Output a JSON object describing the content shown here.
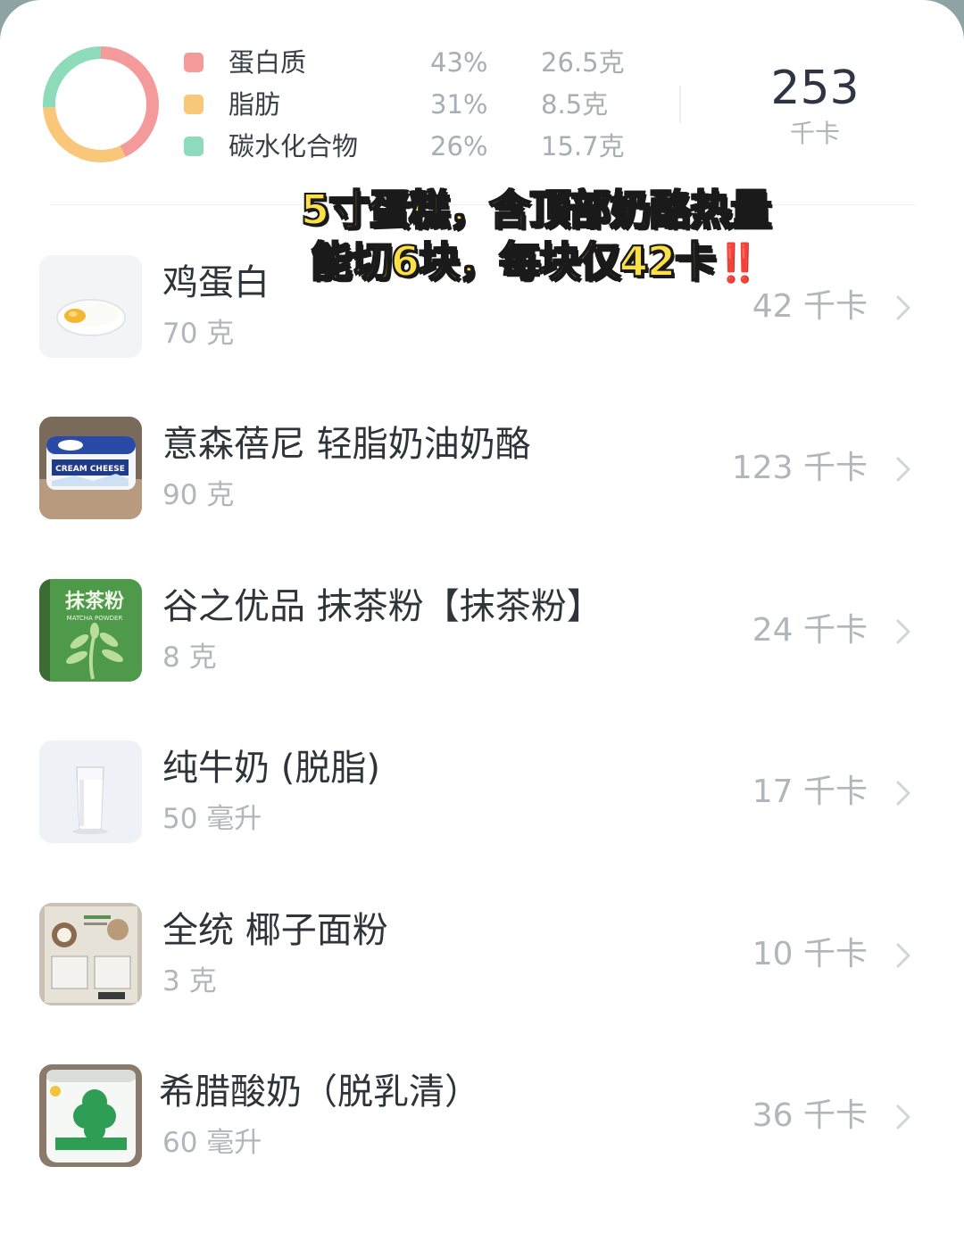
{
  "summary": {
    "macros": [
      {
        "name": "蛋白质",
        "percent": "43%",
        "grams": "26.5克",
        "color": "#f49a9a"
      },
      {
        "name": "脂肪",
        "percent": "31%",
        "grams": "8.5克",
        "color": "#f9c77a"
      },
      {
        "name": "碳水化合物",
        "percent": "26%",
        "grams": "15.7克",
        "color": "#8edbbb"
      }
    ],
    "total_calories": "253",
    "total_unit": "千卡",
    "macro_fractions": [
      0.43,
      0.31,
      0.26
    ]
  },
  "overlay": {
    "line1": "5寸蛋糕，含顶部奶酪热量",
    "line2": "能切6块，每块仅42卡",
    "emoji": "‼️"
  },
  "foods": [
    {
      "name": "鸡蛋白",
      "amount": "70 克",
      "calories": "42 千卡",
      "image": "egg-white-photo"
    },
    {
      "name": "意森蓓尼 轻脂奶油奶酪",
      "amount": "90 克",
      "calories": "123 千卡",
      "image": "cream-cheese-photo"
    },
    {
      "name": "谷之优品 抹茶粉【抹茶粉】",
      "amount": "8 克",
      "calories": "24 千卡",
      "image": "matcha-powder-photo"
    },
    {
      "name": "纯牛奶 (脱脂)",
      "amount": "50 毫升",
      "calories": "17 千卡",
      "image": "milk-glass-photo"
    },
    {
      "name": "全统 椰子面粉",
      "amount": "3 克",
      "calories": "10 千卡",
      "image": "coconut-flour-photo"
    },
    {
      "name": "希腊酸奶（脱乳清）",
      "amount": "60 毫升",
      "calories": "36 千卡",
      "image": "greek-yogurt-photo"
    }
  ],
  "thumb_text": {
    "cream_cheese": "CREAM CHEESE",
    "matcha_cn": "抹茶粉",
    "matcha_en": "MATCHA POWDER"
  }
}
